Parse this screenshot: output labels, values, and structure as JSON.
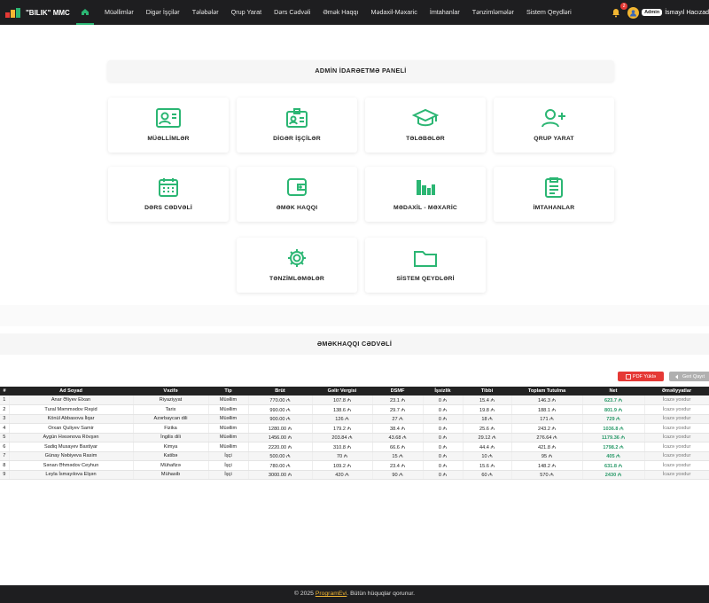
{
  "brand": "\"BILIK\" MMC",
  "nav": [
    "Müəllimlər",
    "Digər İşçilər",
    "Tələbələr",
    "Qrup Yarat",
    "Dərs Cədvəli",
    "Əmək Haqqı",
    "Mədaxil-Məxaric",
    "İmtahanlar",
    "Tənzimləmələr",
    "Sistem Qeydləri"
  ],
  "notification_count": "2",
  "user": {
    "role": "Admin",
    "name": "İsmayıl Hacızad"
  },
  "panel_title": "ADMİN İDARƏETMƏ PANELİ",
  "cards": [
    {
      "label": "MÜƏLLİMLƏR",
      "icon": "teacher-icon"
    },
    {
      "label": "DİGƏR İŞÇİLƏR",
      "icon": "id-badge-icon"
    },
    {
      "label": "TƏLƏBƏLƏR",
      "icon": "graduation-cap-icon"
    },
    {
      "label": "QRUP YARAT",
      "icon": "user-plus-icon"
    },
    {
      "label": "DƏRS CƏDVƏLİ",
      "icon": "calendar-icon"
    },
    {
      "label": "ƏMƏK HAQQI",
      "icon": "wallet-icon"
    },
    {
      "label": "MƏDAXİL - MƏXARİC",
      "icon": "bar-chart-icon"
    },
    {
      "label": "İMTAHANLAR",
      "icon": "clipboard-icon"
    },
    {
      "label": "TƏNZİMLƏMƏLƏR",
      "icon": "gear-icon"
    },
    {
      "label": "SİSTEM QEYDLƏRİ",
      "icon": "folder-icon"
    }
  ],
  "salary_title": "ƏMƏKHAQQI CƏDVƏLİ",
  "buttons": {
    "pdf": "PDF Yüklə",
    "back": "Geri Qayıt"
  },
  "table": {
    "headers": [
      "#",
      "Ad Soyad",
      "Vəzifə",
      "Tip",
      "Brüt",
      "Gəlir Vergisi",
      "DSMF",
      "İşsizlik",
      "Tibbi",
      "Toplam Tutulma",
      "Net",
      "Əməliyyatlar"
    ],
    "rows": [
      [
        "1",
        "Anar Əliyev Elxan",
        "Riyaziyyat",
        "Müəllim",
        "770.00 ₼",
        "107.8 ₼",
        "23.1 ₼",
        "0 ₼",
        "15.4 ₼",
        "146.3 ₼",
        "623.7 ₼",
        "İcazə yoxdur"
      ],
      [
        "2",
        "Tural Məmmədov Rəşid",
        "Tarix",
        "Müəllim",
        "990.00 ₼",
        "138.6 ₼",
        "29.7 ₼",
        "0 ₼",
        "19.8 ₼",
        "188.1 ₼",
        "801.9 ₼",
        "İcazə yoxdur"
      ],
      [
        "3",
        "Könül Abbasova İlqar",
        "Azərbaycan dili",
        "Müəllim",
        "900.00 ₼",
        "126 ₼",
        "27 ₼",
        "0 ₼",
        "18 ₼",
        "171 ₼",
        "729 ₼",
        "İcazə yoxdur"
      ],
      [
        "4",
        "Orxan Quliyev Samir",
        "Fizika",
        "Müəllim",
        "1280.00 ₼",
        "179.2 ₼",
        "38.4 ₼",
        "0 ₼",
        "25.6 ₼",
        "243.2 ₼",
        "1036.8 ₼",
        "İcazə yoxdur"
      ],
      [
        "5",
        "Aygün Həsənova Rövşən",
        "İngilis dili",
        "Müəllim",
        "1456.00 ₼",
        "203.84 ₼",
        "43.68 ₼",
        "0 ₼",
        "29.12 ₼",
        "276.64 ₼",
        "1179.36 ₼",
        "İcazə yoxdur"
      ],
      [
        "6",
        "Sadiq Musayev Baxtiyar",
        "Kimya",
        "Müəllim",
        "2220.00 ₼",
        "310.8 ₼",
        "66.6 ₼",
        "0 ₼",
        "44.4 ₼",
        "421.8 ₼",
        "1798.2 ₼",
        "İcazə yoxdur"
      ],
      [
        "7",
        "Günay Nəbiyeva Rasim",
        "Katibə",
        "İşçi",
        "500.00 ₼",
        "70 ₼",
        "15 ₼",
        "0 ₼",
        "10 ₼",
        "95 ₼",
        "405 ₼",
        "İcazə yoxdur"
      ],
      [
        "8",
        "Sənan Əhmədov Ceyhun",
        "Mühafizə",
        "İşçi",
        "780.00 ₼",
        "109.2 ₼",
        "23.4 ₼",
        "0 ₼",
        "15.6 ₼",
        "148.2 ₼",
        "631.8 ₼",
        "İcazə yoxdur"
      ],
      [
        "9",
        "Leyla İsmayılova Elşən",
        "Mühasib",
        "İşçi",
        "3000.00 ₼",
        "420 ₼",
        "90 ₼",
        "0 ₼",
        "60 ₼",
        "570 ₼",
        "2430 ₼",
        "İcazə yoxdur"
      ]
    ]
  },
  "footer": {
    "prefix": "© 2025 ",
    "link": "ProgramEvi",
    "suffix": ". Bütün hüquqlar qorunur."
  },
  "colors": {
    "accent": "#2bb673",
    "navbar": "#1e1e20",
    "danger": "#e53935",
    "net_text": "#2b9a6a"
  }
}
